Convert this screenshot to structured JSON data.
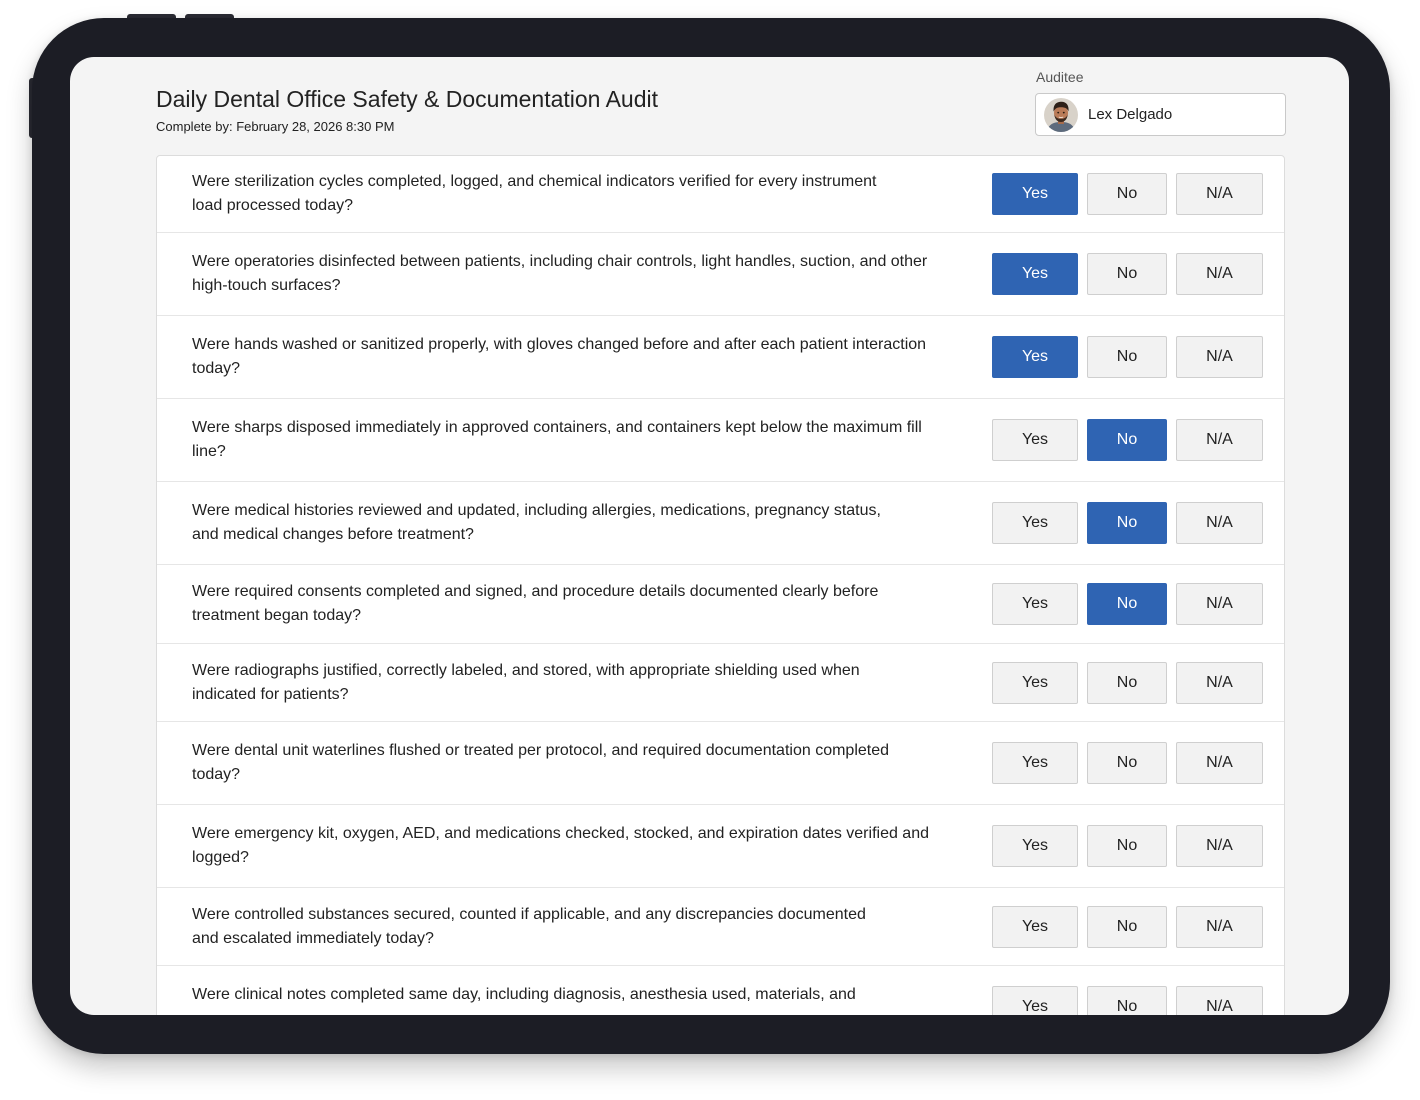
{
  "audit": {
    "title": "Daily Dental Office Safety & Documentation Audit",
    "due": "Complete by: February 28, 2026 8:30 PM"
  },
  "auditee": {
    "label": "Auditee",
    "name": "Lex Delgado",
    "avatar_icon": "user-avatar-photo"
  },
  "answer_options": [
    "Yes",
    "No",
    "N/A"
  ],
  "colors": {
    "selected_bg": "#2f64b3",
    "selected_text": "#ffffff",
    "device_frame": "#1c1d25",
    "screen_bg": "#f4f4f4"
  },
  "questions": [
    {
      "text": "Were sterilization cycles completed, logged, and chemical indicators verified for every instrument\nload processed today?",
      "answer": "Yes"
    },
    {
      "text": "Were operatories disinfected between patients, including chair controls, light handles, suction, and other\nhigh-touch surfaces?",
      "answer": "Yes"
    },
    {
      "text": "Were hands washed or sanitized properly, with gloves changed before and after each patient interaction\ntoday?",
      "answer": "Yes"
    },
    {
      "text": "Were sharps disposed immediately in approved containers, and containers kept below the maximum fill\nline?",
      "answer": "No"
    },
    {
      "text": "Were medical histories reviewed and updated, including allergies, medications, pregnancy status,\nand medical changes before treatment?",
      "answer": "No"
    },
    {
      "text": "Were required consents completed and signed, and procedure details documented clearly before\ntreatment began today?",
      "answer": "No"
    },
    {
      "text": "Were radiographs justified, correctly labeled, and stored, with appropriate shielding used when\nindicated for patients?",
      "answer": null
    },
    {
      "text": "Were dental unit waterlines flushed or treated per protocol, and required documentation completed\ntoday?",
      "answer": null
    },
    {
      "text": "Were emergency kit, oxygen, AED, and medications checked, stocked, and expiration dates verified and\nlogged?",
      "answer": null
    },
    {
      "text": "Were controlled substances secured, counted if applicable, and any discrepancies documented\nand escalated immediately today?",
      "answer": null
    },
    {
      "text": "Were clinical notes completed same day, including diagnosis, anesthesia used, materials, and",
      "answer": null
    }
  ]
}
